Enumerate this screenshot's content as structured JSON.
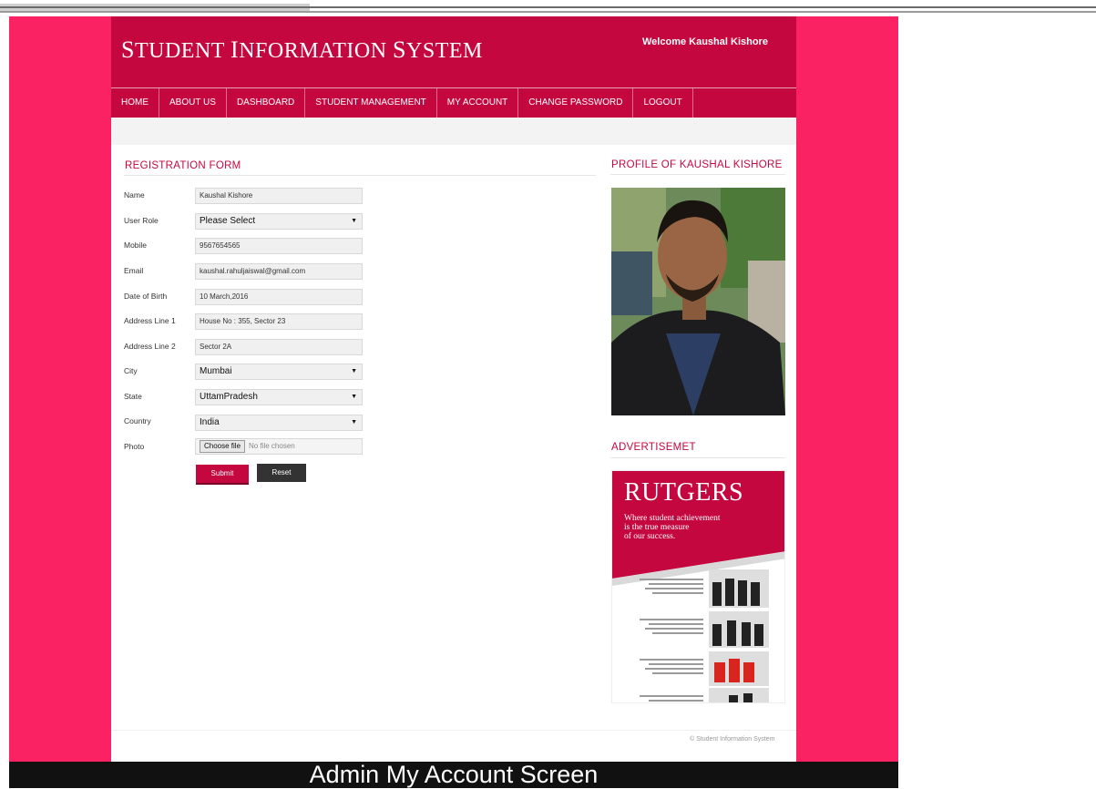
{
  "header": {
    "title_first_1": "S",
    "title_rest_1": "TUDENT ",
    "title_first_2": "I",
    "title_rest_2": "NFORMATION ",
    "title_first_3": "S",
    "title_rest_3": "YSTEM",
    "welcome": "Welcome Kaushal Kishore"
  },
  "nav": [
    "HOME",
    "ABOUT US",
    "DASHBOARD",
    "STUDENT MANAGEMENT",
    "MY ACCOUNT",
    "CHANGE PASSWORD",
    "LOGOUT"
  ],
  "form": {
    "title": "REGISTRATION FORM",
    "fields": {
      "name": {
        "label": "Name",
        "value": "Kaushal Kishore"
      },
      "user_role": {
        "label": "User Role",
        "value": "Please Select"
      },
      "mobile": {
        "label": "Mobile",
        "value": "9567654565"
      },
      "email": {
        "label": "Email",
        "value": "kaushal.rahuljaiswal@gmail.com"
      },
      "dob": {
        "label": "Date of Birth",
        "value": "10 March,2016"
      },
      "address1": {
        "label": "Address Line 1",
        "value": "House No : 355, Sector 23"
      },
      "address2": {
        "label": "Address Line 2",
        "value": "Sector 2A"
      },
      "city": {
        "label": "City",
        "value": "Mumbai"
      },
      "state": {
        "label": "State",
        "value": "UttamPradesh"
      },
      "country": {
        "label": "Country",
        "value": "India"
      },
      "photo": {
        "label": "Photo",
        "button": "Choose file",
        "status": "No file chosen"
      }
    },
    "submit": "Submit",
    "reset": "Reset"
  },
  "sidebar": {
    "profile_title": "PROFILE OF KAUSHAL KISHORE",
    "ad_title": "ADVERTISEMET",
    "ad": {
      "brand": "RUTGERS",
      "tagline_1": "Where student achievement",
      "tagline_2": "is the true measure",
      "tagline_3": "of our success."
    }
  },
  "footer": {
    "text": "© Student Information System"
  },
  "caption": "Admin My Account Screen",
  "colors": {
    "outer": "#fb2264",
    "header": "#c5073f",
    "reset": "#333333"
  },
  "icons": {
    "select_arrow": "dropdown-arrow-icon"
  }
}
